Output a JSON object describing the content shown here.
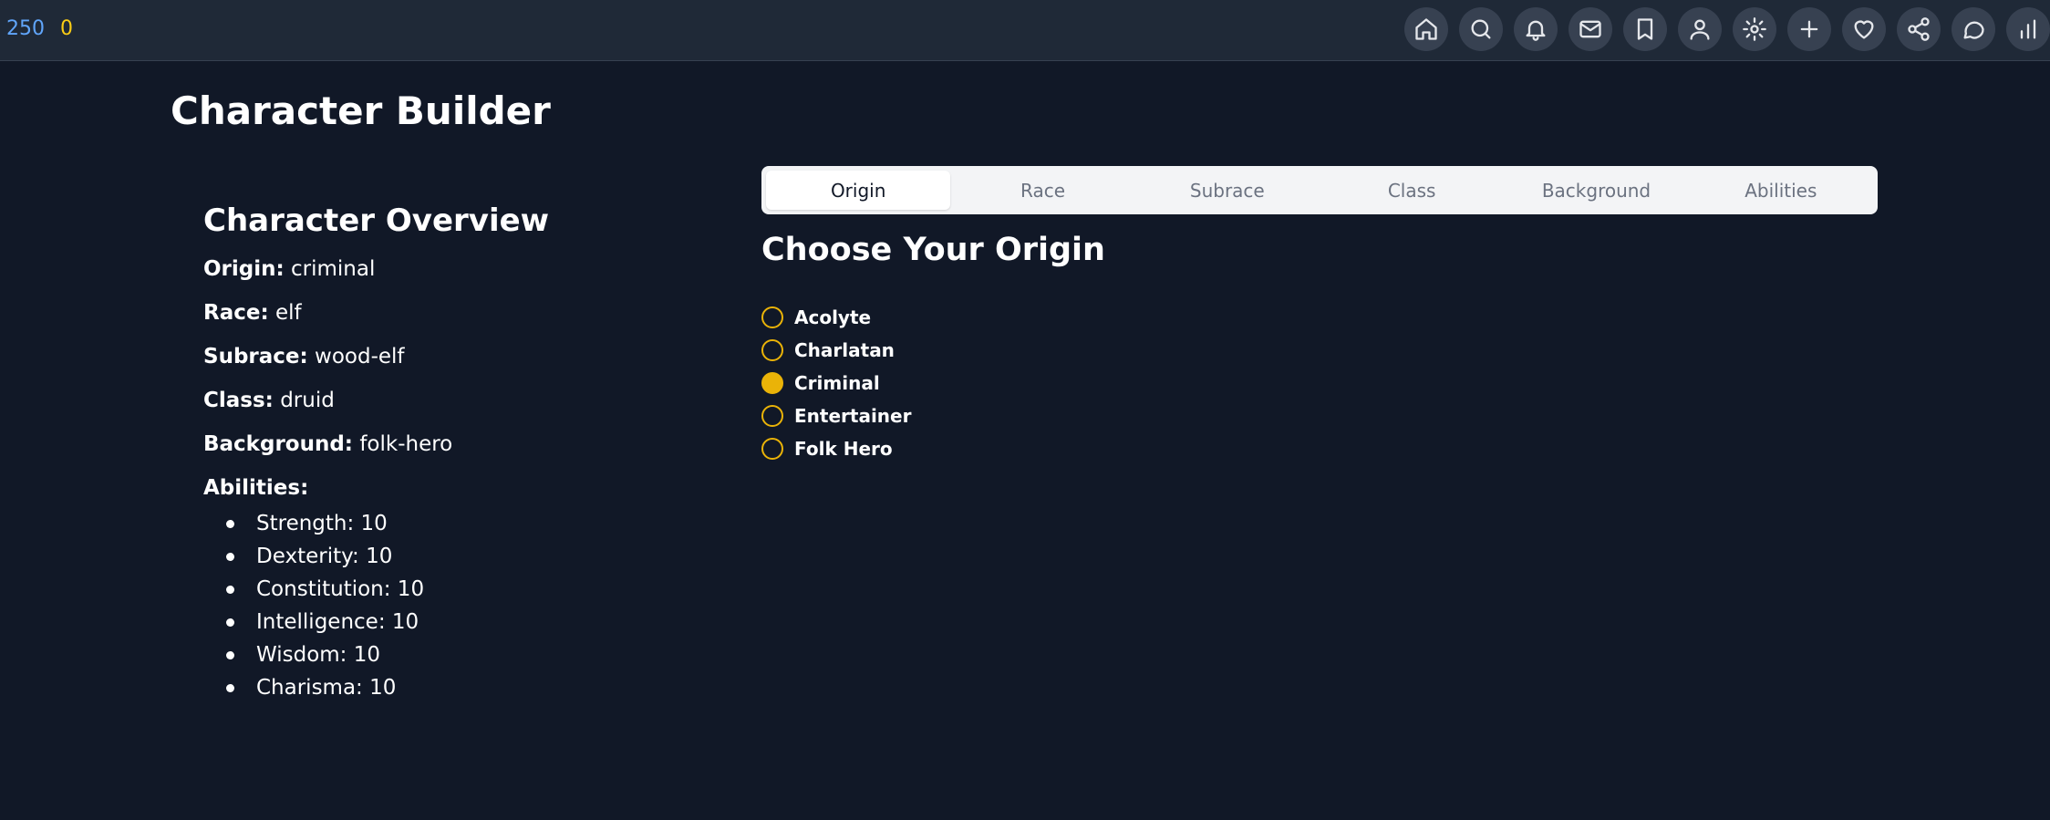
{
  "topbar": {
    "score": "250",
    "coins": "0",
    "icons": [
      "home-icon",
      "search-icon",
      "bell-icon",
      "mail-icon",
      "bookmark-icon",
      "user-icon",
      "gear-icon",
      "plus-icon",
      "heart-icon",
      "share-icon",
      "chat-icon",
      "chart-icon"
    ]
  },
  "page": {
    "title": "Character Builder"
  },
  "overview": {
    "title": "Character Overview",
    "origin_label": "Origin:",
    "origin_value": "criminal",
    "race_label": "Race:",
    "race_value": "elf",
    "subrace_label": "Subrace:",
    "subrace_value": "wood-elf",
    "class_label": "Class:",
    "class_value": "druid",
    "background_label": "Background:",
    "background_value": "folk-hero",
    "abilities_label": "Abilities:",
    "abilities": [
      "Strength: 10",
      "Dexterity: 10",
      "Constitution: 10",
      "Intelligence: 10",
      "Wisdom: 10",
      "Charisma: 10"
    ]
  },
  "tabs": [
    {
      "label": "Origin",
      "active": true
    },
    {
      "label": "Race"
    },
    {
      "label": "Subrace"
    },
    {
      "label": "Class"
    },
    {
      "label": "Background"
    },
    {
      "label": "Abilities"
    }
  ],
  "origin": {
    "title": "Choose Your Origin",
    "selected": "Criminal",
    "options": [
      "Acolyte",
      "Charlatan",
      "Criminal",
      "Entertainer",
      "Folk Hero"
    ]
  },
  "colors": {
    "accent": "#eab308",
    "score": "#60a5fa",
    "coins": "#facc15",
    "background": "#111827"
  }
}
